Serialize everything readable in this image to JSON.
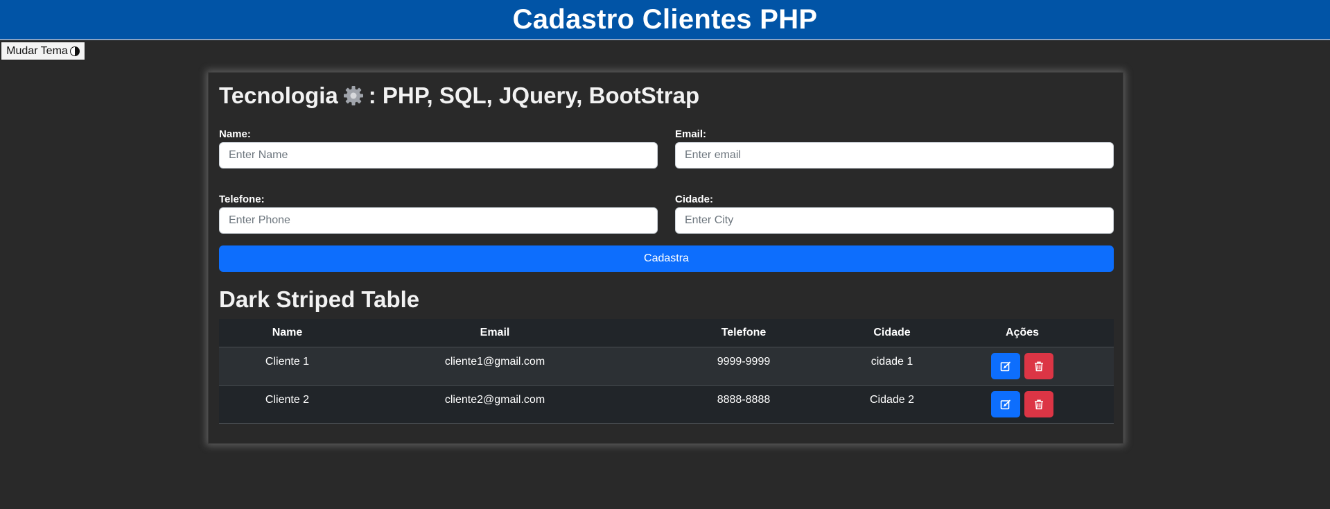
{
  "header": {
    "title": "Cadastro Clientes PHP"
  },
  "theme_button": {
    "label": "Mudar Tema",
    "icon": "half-circle-icon"
  },
  "card": {
    "title_prefix": "Tecnologia",
    "title_icon": "gear-icon",
    "title_suffix": ": PHP, SQL, JQuery, BootStrap"
  },
  "form": {
    "name": {
      "label": "Name:",
      "placeholder": "Enter Name",
      "value": ""
    },
    "email": {
      "label": "Email:",
      "placeholder": "Enter email",
      "value": ""
    },
    "phone": {
      "label": "Telefone:",
      "placeholder": "Enter Phone",
      "value": ""
    },
    "city": {
      "label": "Cidade:",
      "placeholder": "Enter City",
      "value": ""
    },
    "submit_label": "Cadastra"
  },
  "table": {
    "title": "Dark Striped Table",
    "headers": [
      "Name",
      "Email",
      "Telefone",
      "Cidade",
      "Ações"
    ],
    "rows": [
      {
        "name": "Cliente 1",
        "email": "cliente1@gmail.com",
        "phone": "9999-9999",
        "city": "cidade 1"
      },
      {
        "name": "Cliente 2",
        "email": "cliente2@gmail.com",
        "phone": "8888-8888",
        "city": "Cidade 2"
      }
    ],
    "actions": {
      "edit_icon": "edit-icon",
      "delete_icon": "trash-icon"
    }
  },
  "colors": {
    "header_bg": "#0154a6",
    "page_bg": "#292929",
    "primary": "#0d6efd",
    "danger": "#dc3545",
    "table_dark": "#212529",
    "table_stripe": "#2c3034"
  }
}
